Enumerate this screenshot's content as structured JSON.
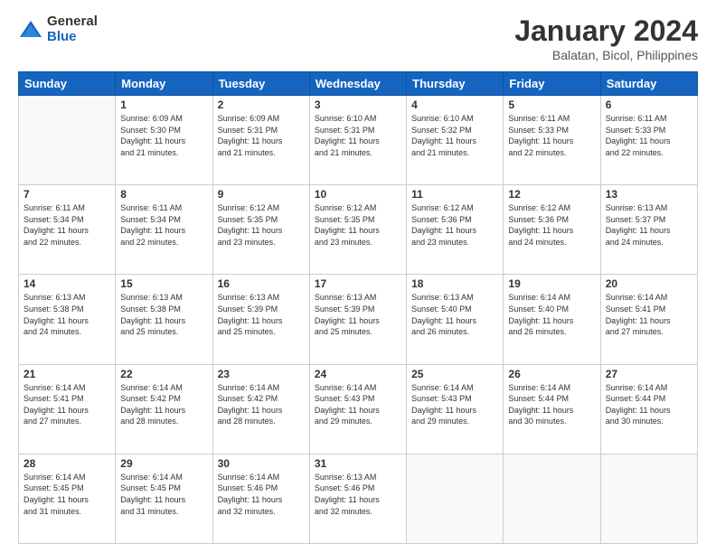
{
  "logo": {
    "general": "General",
    "blue": "Blue"
  },
  "title": "January 2024",
  "subtitle": "Balatan, Bicol, Philippines",
  "days_of_week": [
    "Sunday",
    "Monday",
    "Tuesday",
    "Wednesday",
    "Thursday",
    "Friday",
    "Saturday"
  ],
  "weeks": [
    [
      {
        "day": "",
        "info": ""
      },
      {
        "day": "1",
        "info": "Sunrise: 6:09 AM\nSunset: 5:30 PM\nDaylight: 11 hours\nand 21 minutes."
      },
      {
        "day": "2",
        "info": "Sunrise: 6:09 AM\nSunset: 5:31 PM\nDaylight: 11 hours\nand 21 minutes."
      },
      {
        "day": "3",
        "info": "Sunrise: 6:10 AM\nSunset: 5:31 PM\nDaylight: 11 hours\nand 21 minutes."
      },
      {
        "day": "4",
        "info": "Sunrise: 6:10 AM\nSunset: 5:32 PM\nDaylight: 11 hours\nand 21 minutes."
      },
      {
        "day": "5",
        "info": "Sunrise: 6:11 AM\nSunset: 5:33 PM\nDaylight: 11 hours\nand 22 minutes."
      },
      {
        "day": "6",
        "info": "Sunrise: 6:11 AM\nSunset: 5:33 PM\nDaylight: 11 hours\nand 22 minutes."
      }
    ],
    [
      {
        "day": "7",
        "info": "Sunrise: 6:11 AM\nSunset: 5:34 PM\nDaylight: 11 hours\nand 22 minutes."
      },
      {
        "day": "8",
        "info": "Sunrise: 6:11 AM\nSunset: 5:34 PM\nDaylight: 11 hours\nand 22 minutes."
      },
      {
        "day": "9",
        "info": "Sunrise: 6:12 AM\nSunset: 5:35 PM\nDaylight: 11 hours\nand 23 minutes."
      },
      {
        "day": "10",
        "info": "Sunrise: 6:12 AM\nSunset: 5:35 PM\nDaylight: 11 hours\nand 23 minutes."
      },
      {
        "day": "11",
        "info": "Sunrise: 6:12 AM\nSunset: 5:36 PM\nDaylight: 11 hours\nand 23 minutes."
      },
      {
        "day": "12",
        "info": "Sunrise: 6:12 AM\nSunset: 5:36 PM\nDaylight: 11 hours\nand 24 minutes."
      },
      {
        "day": "13",
        "info": "Sunrise: 6:13 AM\nSunset: 5:37 PM\nDaylight: 11 hours\nand 24 minutes."
      }
    ],
    [
      {
        "day": "14",
        "info": "Sunrise: 6:13 AM\nSunset: 5:38 PM\nDaylight: 11 hours\nand 24 minutes."
      },
      {
        "day": "15",
        "info": "Sunrise: 6:13 AM\nSunset: 5:38 PM\nDaylight: 11 hours\nand 25 minutes."
      },
      {
        "day": "16",
        "info": "Sunrise: 6:13 AM\nSunset: 5:39 PM\nDaylight: 11 hours\nand 25 minutes."
      },
      {
        "day": "17",
        "info": "Sunrise: 6:13 AM\nSunset: 5:39 PM\nDaylight: 11 hours\nand 25 minutes."
      },
      {
        "day": "18",
        "info": "Sunrise: 6:13 AM\nSunset: 5:40 PM\nDaylight: 11 hours\nand 26 minutes."
      },
      {
        "day": "19",
        "info": "Sunrise: 6:14 AM\nSunset: 5:40 PM\nDaylight: 11 hours\nand 26 minutes."
      },
      {
        "day": "20",
        "info": "Sunrise: 6:14 AM\nSunset: 5:41 PM\nDaylight: 11 hours\nand 27 minutes."
      }
    ],
    [
      {
        "day": "21",
        "info": "Sunrise: 6:14 AM\nSunset: 5:41 PM\nDaylight: 11 hours\nand 27 minutes."
      },
      {
        "day": "22",
        "info": "Sunrise: 6:14 AM\nSunset: 5:42 PM\nDaylight: 11 hours\nand 28 minutes."
      },
      {
        "day": "23",
        "info": "Sunrise: 6:14 AM\nSunset: 5:42 PM\nDaylight: 11 hours\nand 28 minutes."
      },
      {
        "day": "24",
        "info": "Sunrise: 6:14 AM\nSunset: 5:43 PM\nDaylight: 11 hours\nand 29 minutes."
      },
      {
        "day": "25",
        "info": "Sunrise: 6:14 AM\nSunset: 5:43 PM\nDaylight: 11 hours\nand 29 minutes."
      },
      {
        "day": "26",
        "info": "Sunrise: 6:14 AM\nSunset: 5:44 PM\nDaylight: 11 hours\nand 30 minutes."
      },
      {
        "day": "27",
        "info": "Sunrise: 6:14 AM\nSunset: 5:44 PM\nDaylight: 11 hours\nand 30 minutes."
      }
    ],
    [
      {
        "day": "28",
        "info": "Sunrise: 6:14 AM\nSunset: 5:45 PM\nDaylight: 11 hours\nand 31 minutes."
      },
      {
        "day": "29",
        "info": "Sunrise: 6:14 AM\nSunset: 5:45 PM\nDaylight: 11 hours\nand 31 minutes."
      },
      {
        "day": "30",
        "info": "Sunrise: 6:14 AM\nSunset: 5:46 PM\nDaylight: 11 hours\nand 32 minutes."
      },
      {
        "day": "31",
        "info": "Sunrise: 6:13 AM\nSunset: 5:46 PM\nDaylight: 11 hours\nand 32 minutes."
      },
      {
        "day": "",
        "info": ""
      },
      {
        "day": "",
        "info": ""
      },
      {
        "day": "",
        "info": ""
      }
    ]
  ]
}
